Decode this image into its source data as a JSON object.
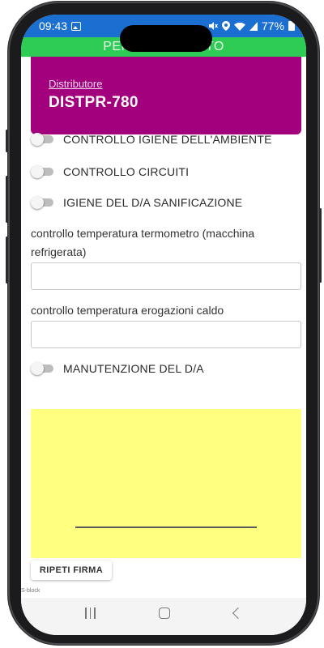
{
  "status_bar": {
    "time": "09:43",
    "image_icon": "image-icon",
    "right_icons": "mute-icon location-icon wifi-icon signal-icon",
    "battery": "77%"
  },
  "app_bar": {
    "title": "PERSONALIZZATO",
    "color": "#2ecc55"
  },
  "distributor": {
    "label": "Distributore",
    "value": "DISTPR-780",
    "color": "#a3007d"
  },
  "toggles": [
    {
      "label": "CONTROLLO IGIENE DELL'AMBIENTE",
      "on": false
    },
    {
      "label": "CONTROLLO CIRCUITI",
      "on": false
    },
    {
      "label": "IGIENE DEL D/A SANIFICAZIONE",
      "on": false
    },
    {
      "label": "MANUTENZIONE DEL D/A",
      "on": false
    }
  ],
  "fields": [
    {
      "label": "controllo temperatura termometro (macchina refrigerata)",
      "value": ""
    },
    {
      "label": "controllo temperatura erogazioni caldo",
      "value": ""
    }
  ],
  "signature": {
    "background": "#ffff80",
    "repeat_label": "RIPETI FIRMA",
    "footer_text": "S-block"
  },
  "nav_bar": {
    "icons": [
      "recent-apps-icon",
      "home-icon",
      "back-icon"
    ]
  }
}
